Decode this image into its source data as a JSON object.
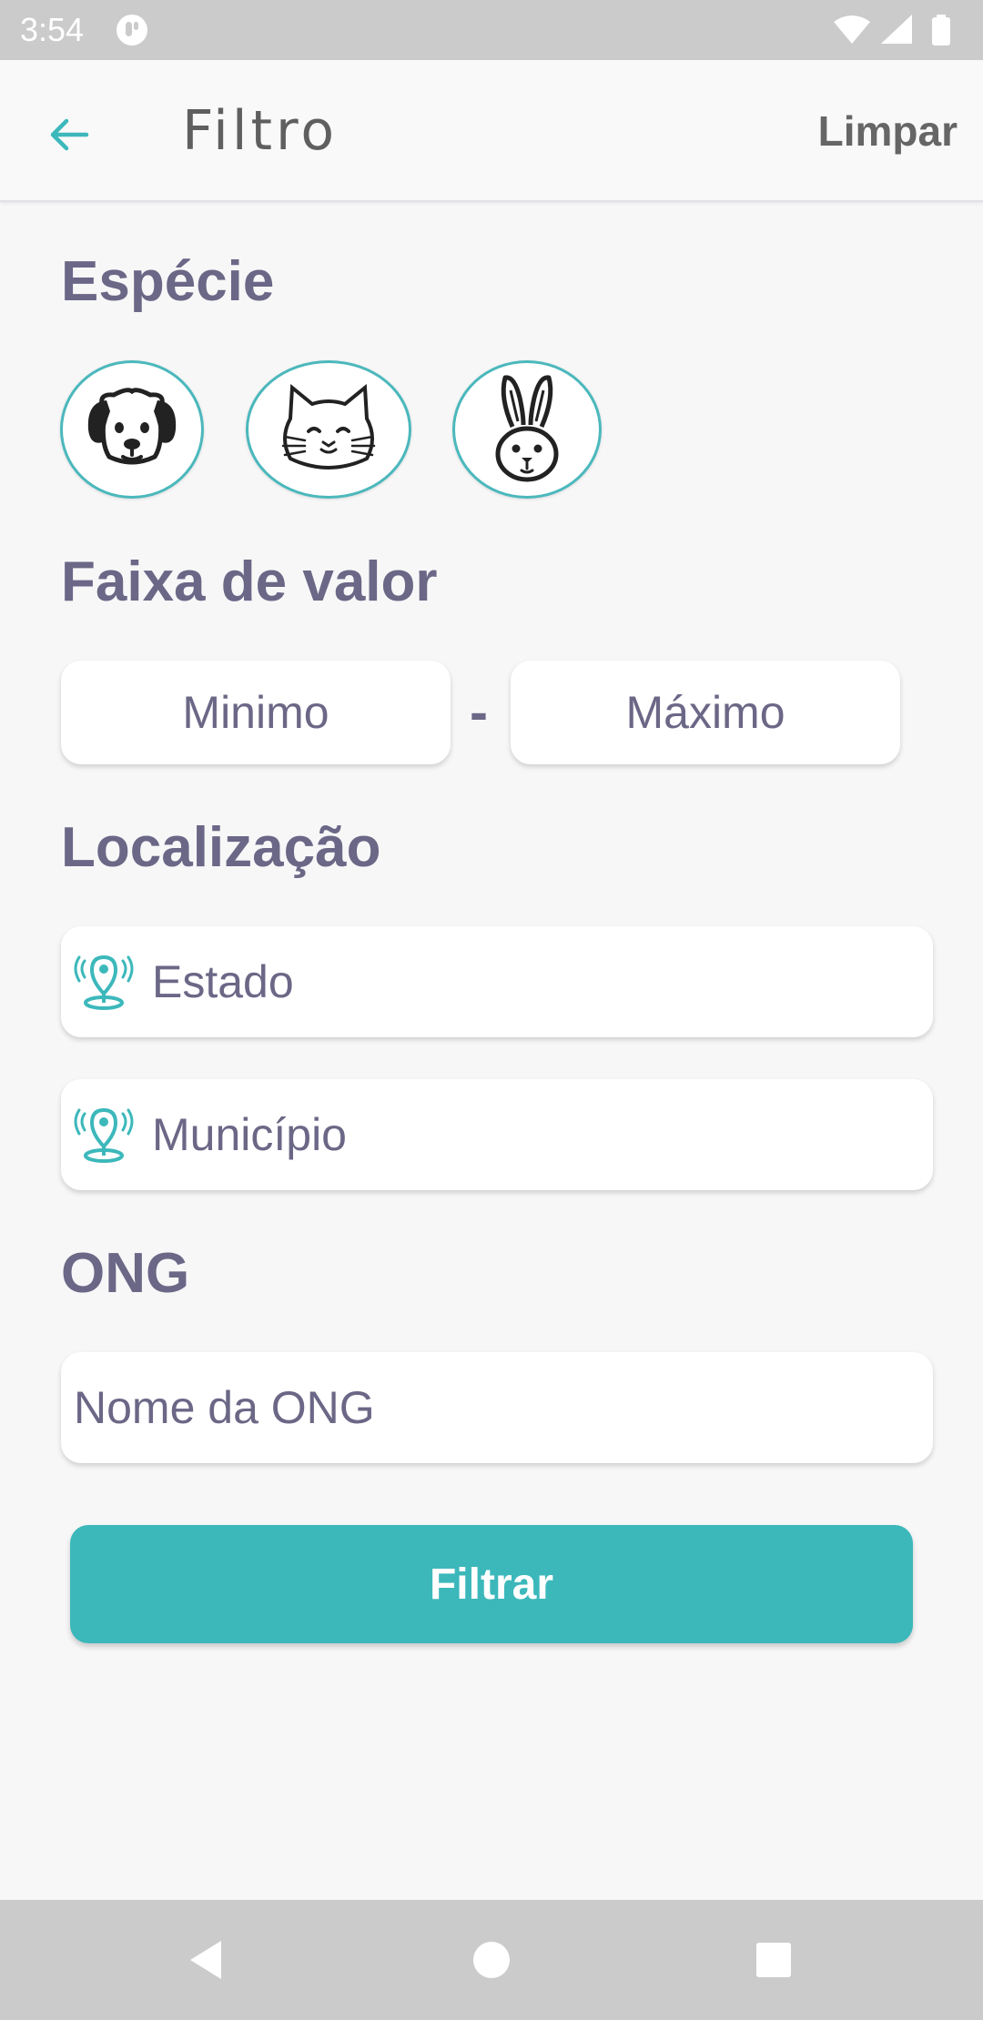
{
  "status_bar": {
    "time": "3:54",
    "icons": [
      "app-notification-icon",
      "wifi-icon",
      "signal-icon",
      "battery-icon"
    ]
  },
  "app_bar": {
    "back_icon": "arrow-left-icon",
    "title": "Filtro",
    "clear_label": "Limpar"
  },
  "sections": {
    "species": "Espécie",
    "price_range": "Faixa de valor",
    "location": "Localização",
    "ong": "ONG"
  },
  "species_options": [
    "dog-icon",
    "cat-icon",
    "rabbit-icon"
  ],
  "price_range": {
    "min_placeholder": "Minimo",
    "separator": "-",
    "max_placeholder": "Máximo"
  },
  "location": {
    "state_placeholder": "Estado",
    "city_placeholder": "Município",
    "field_icon": "location-pin-icon"
  },
  "ong": {
    "name_placeholder": "Nome da ONG"
  },
  "filter_button_label": "Filtrar",
  "colors": {
    "accent": "#3cb8bb",
    "heading": "#6b6786",
    "background": "#f7f7f8",
    "system_bars": "#cbcbcb"
  },
  "nav_bar": [
    "back-triangle-icon",
    "home-circle-icon",
    "recents-square-icon"
  ]
}
